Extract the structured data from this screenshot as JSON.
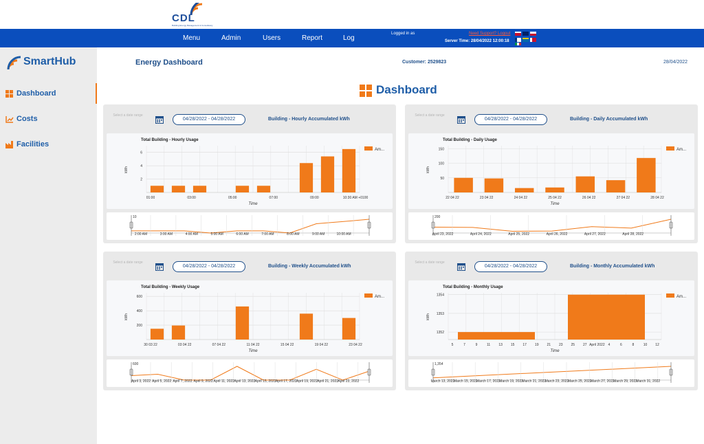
{
  "header": {
    "cdl_logo_text": "CDL",
    "cdl_logo_subtitle": "Building Energy Management & Consultancy",
    "nav": [
      "Menu",
      "Admin",
      "Users",
      "Report",
      "Log"
    ],
    "logged_in": "Logged in as",
    "support": "Need Support? Logout",
    "server_time": "Server Time: 28/04/2022 12:00:18"
  },
  "sidebar": {
    "brand": "SmartHub",
    "items": [
      {
        "label": "Dashboard",
        "icon": "grid-icon"
      },
      {
        "label": "Costs",
        "icon": "trend-icon"
      },
      {
        "label": "Facilities",
        "icon": "factory-icon"
      }
    ]
  },
  "page": {
    "title": "Energy Dashboard",
    "customer": "Customer: 2529823",
    "date": "28/04/2022",
    "dashboard_title": "Dashboard"
  },
  "panels": [
    {
      "hint": "Select a date range",
      "range": "04/28/2022 - 04/28/2022",
      "title": "Building - Hourly Accumulated kWh"
    },
    {
      "hint": "Select a date range",
      "range": "04/28/2022 - 04/28/2022",
      "title": "Building - Daily Accumulated kWh"
    },
    {
      "hint": "Select a date range",
      "range": "04/28/2022 - 04/28/2022",
      "title": "Building - Weekly Accumulated kWh"
    },
    {
      "hint": "Select a date range",
      "range": "04/28/2022 - 04/28/2022",
      "title": "Building - Monthly Accumulated kWh"
    }
  ],
  "colors": {
    "accent": "#f07a1a",
    "nav": "#0a4ebd",
    "brand": "#1f5ea8"
  },
  "chart_data": [
    {
      "type": "bar",
      "title": "Total Building - Hourly Usage",
      "xlabel": "Time",
      "ylabel": "kWh",
      "legend": "Am...",
      "legend_position": "top-right",
      "ylim": [
        0,
        7
      ],
      "yticks": [
        2,
        4,
        6
      ],
      "xticks": [
        "01:00",
        "03:00",
        "05:00",
        "07:00",
        "09:00",
        "10:30 AM +0100"
      ],
      "series": [
        {
          "values": [
            1,
            1,
            1,
            0,
            1,
            1,
            0,
            4.4,
            5.4,
            6.5
          ]
        }
      ],
      "navigator": {
        "ymax_label": "10",
        "ticks": [
          "2:00 AM",
          "3:00 AM",
          "4:00 AM",
          "5:00 AM",
          "6:00 AM",
          "7:00 AM",
          "8:00 AM",
          "9:00 AM",
          "10:00 AM"
        ]
      }
    },
    {
      "type": "bar",
      "title": "Total Building - Daily Usage",
      "xlabel": "Time",
      "ylabel": "kWh",
      "legend": "Am...",
      "legend_position": "top-right",
      "ylim": [
        0,
        160
      ],
      "yticks": [
        50,
        100,
        150
      ],
      "xticks": [
        "22 04 22",
        "23 04 22",
        "24 04 22",
        "25 04 22",
        "26 04 22",
        "27 04 22",
        "28 04 22"
      ],
      "series": [
        {
          "values": [
            50,
            48,
            15,
            17,
            55,
            42,
            118
          ]
        }
      ],
      "navigator": {
        "ymax_label": "200",
        "ticks": [
          "April 23, 2022",
          "April 24, 2022",
          "April 25, 2022",
          "April 26, 2022",
          "April 27, 2022",
          "April 28, 2022"
        ]
      }
    },
    {
      "type": "bar",
      "title": "Total Building - Weekly Usage",
      "xlabel": "Time",
      "ylabel": "kWh",
      "legend": "Am...",
      "legend_position": "top-right",
      "ylim": [
        0,
        650
      ],
      "yticks": [
        200,
        400,
        600
      ],
      "xticks": [
        "30 03 22",
        "03 04 22",
        "07 04 22",
        "11 04 22",
        "15 04 22",
        "19 04 22",
        "23 04 22"
      ],
      "series": [
        {
          "values": [
            150,
            195,
            0,
            0,
            460,
            0,
            0,
            360,
            0,
            300
          ]
        }
      ],
      "navigator": {
        "ymax_label": "600",
        "ticks": [
          "April 3, 2022",
          "April 5, 2022",
          "April 7, 2022",
          "April 9, 2022",
          "April 11, 2022",
          "April 13, 2022",
          "April 15, 2022",
          "April 17, 2022",
          "April 19, 2022",
          "April 21, 2022",
          "April 23, 2022"
        ]
      }
    },
    {
      "type": "bar",
      "title": "Total Building - Monthly Usage",
      "xlabel": "Time",
      "ylabel": "kWh",
      "legend": "Am...",
      "legend_position": "top-right",
      "ylim": [
        1351.6,
        1354.1
      ],
      "yticks": [
        1352,
        1353,
        1354
      ],
      "xticks": [
        "5",
        "7",
        "9",
        "11",
        "13",
        "15",
        "17",
        "19",
        "21",
        "23",
        "25",
        "27",
        "April 2022",
        "4",
        "6",
        "8",
        "10",
        "12"
      ],
      "series": [
        {
          "values": [
            1352,
            1354
          ]
        }
      ],
      "navigator": {
        "ymax_label": "1,354",
        "ticks": [
          "March 13, 2022",
          "March 15, 2022",
          "March 17, 2022",
          "March 19, 2022",
          "March 21, 2022",
          "March 23, 2022",
          "March 25, 2022",
          "March 27, 2022",
          "March 29, 2022",
          "March 31, 2022"
        ]
      }
    }
  ]
}
